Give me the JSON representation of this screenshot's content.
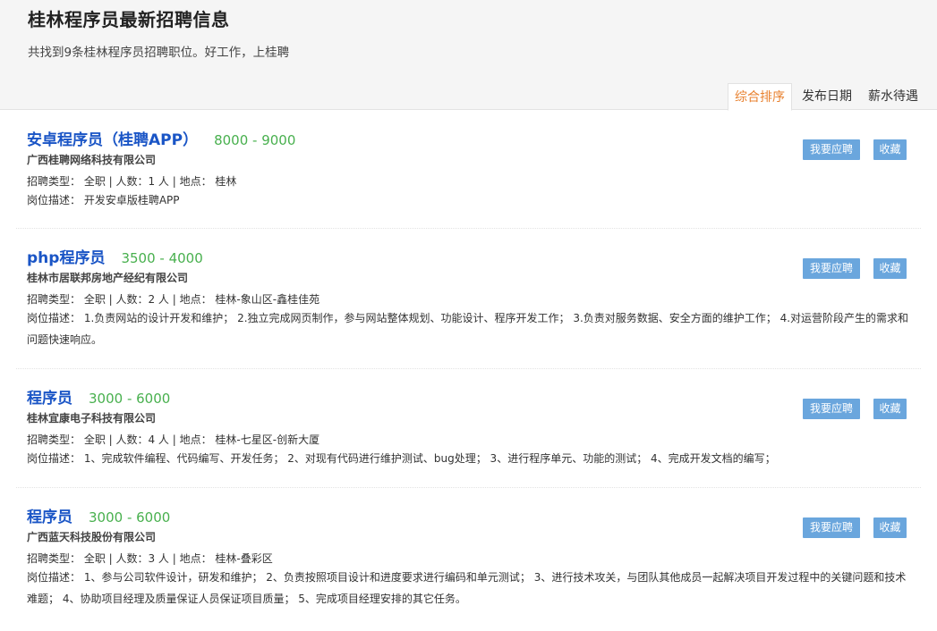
{
  "header": {
    "title": "桂林程序员最新招聘信息",
    "subtitle": "共找到9条桂林程序员招聘职位。好工作，上桂聘"
  },
  "sort_tabs": [
    {
      "label": "综合排序",
      "active": true
    },
    {
      "label": "发布日期",
      "active": false
    },
    {
      "label": "薪水待遇",
      "active": false
    }
  ],
  "buttons": {
    "apply_label": "我要应聘",
    "favorite_label": "收藏"
  },
  "jobs": [
    {
      "title": "安卓程序员（桂聘APP）",
      "salary": "8000 - 9000",
      "company": "广西桂聘网络科技有限公司",
      "meta": "招聘类型：  全职 | 人数：1 人 | 地点：  桂林",
      "description": "岗位描述：  开发安卓版桂聘APP"
    },
    {
      "title": "php程序员",
      "salary": "3500 - 4000",
      "company": "桂林市居联邦房地产经纪有限公司",
      "meta": "招聘类型：  全职 | 人数：2 人 | 地点：  桂林-象山区-鑫桂佳苑",
      "description": "岗位描述：  1.负责网站的设计开发和维护；  2.独立完成网页制作，参与网站整体规划、功能设计、程序开发工作；  3.负责对服务数据、安全方面的维护工作；  4.对运营阶段产生的需求和问题快速响应。"
    },
    {
      "title": "程序员",
      "salary": "3000 - 6000",
      "company": "桂林宜康电子科技有限公司",
      "meta": "招聘类型：  全职 | 人数：4 人 | 地点：  桂林-七星区-创新大厦",
      "description": "岗位描述：  1、完成软件编程、代码编写、开发任务；  2、对现有代码进行维护测试、bug处理；  3、进行程序单元、功能的测试；  4、完成开发文档的编写；"
    },
    {
      "title": "程序员",
      "salary": "3000 - 6000",
      "company": "广西蓝天科技股份有限公司",
      "meta": "招聘类型：  全职 | 人数：3 人 | 地点：  桂林-叠彩区",
      "description": "岗位描述：  1、参与公司软件设计，研发和维护；  2、负责按照项目设计和进度要求进行编码和单元测试；  3、进行技术攻关，与团队其他成员一起解决项目开发过程中的关键问题和技术难题；  4、协助项目经理及质量保证人员保证项目质量；  5、完成项目经理安排的其它任务。"
    }
  ]
}
